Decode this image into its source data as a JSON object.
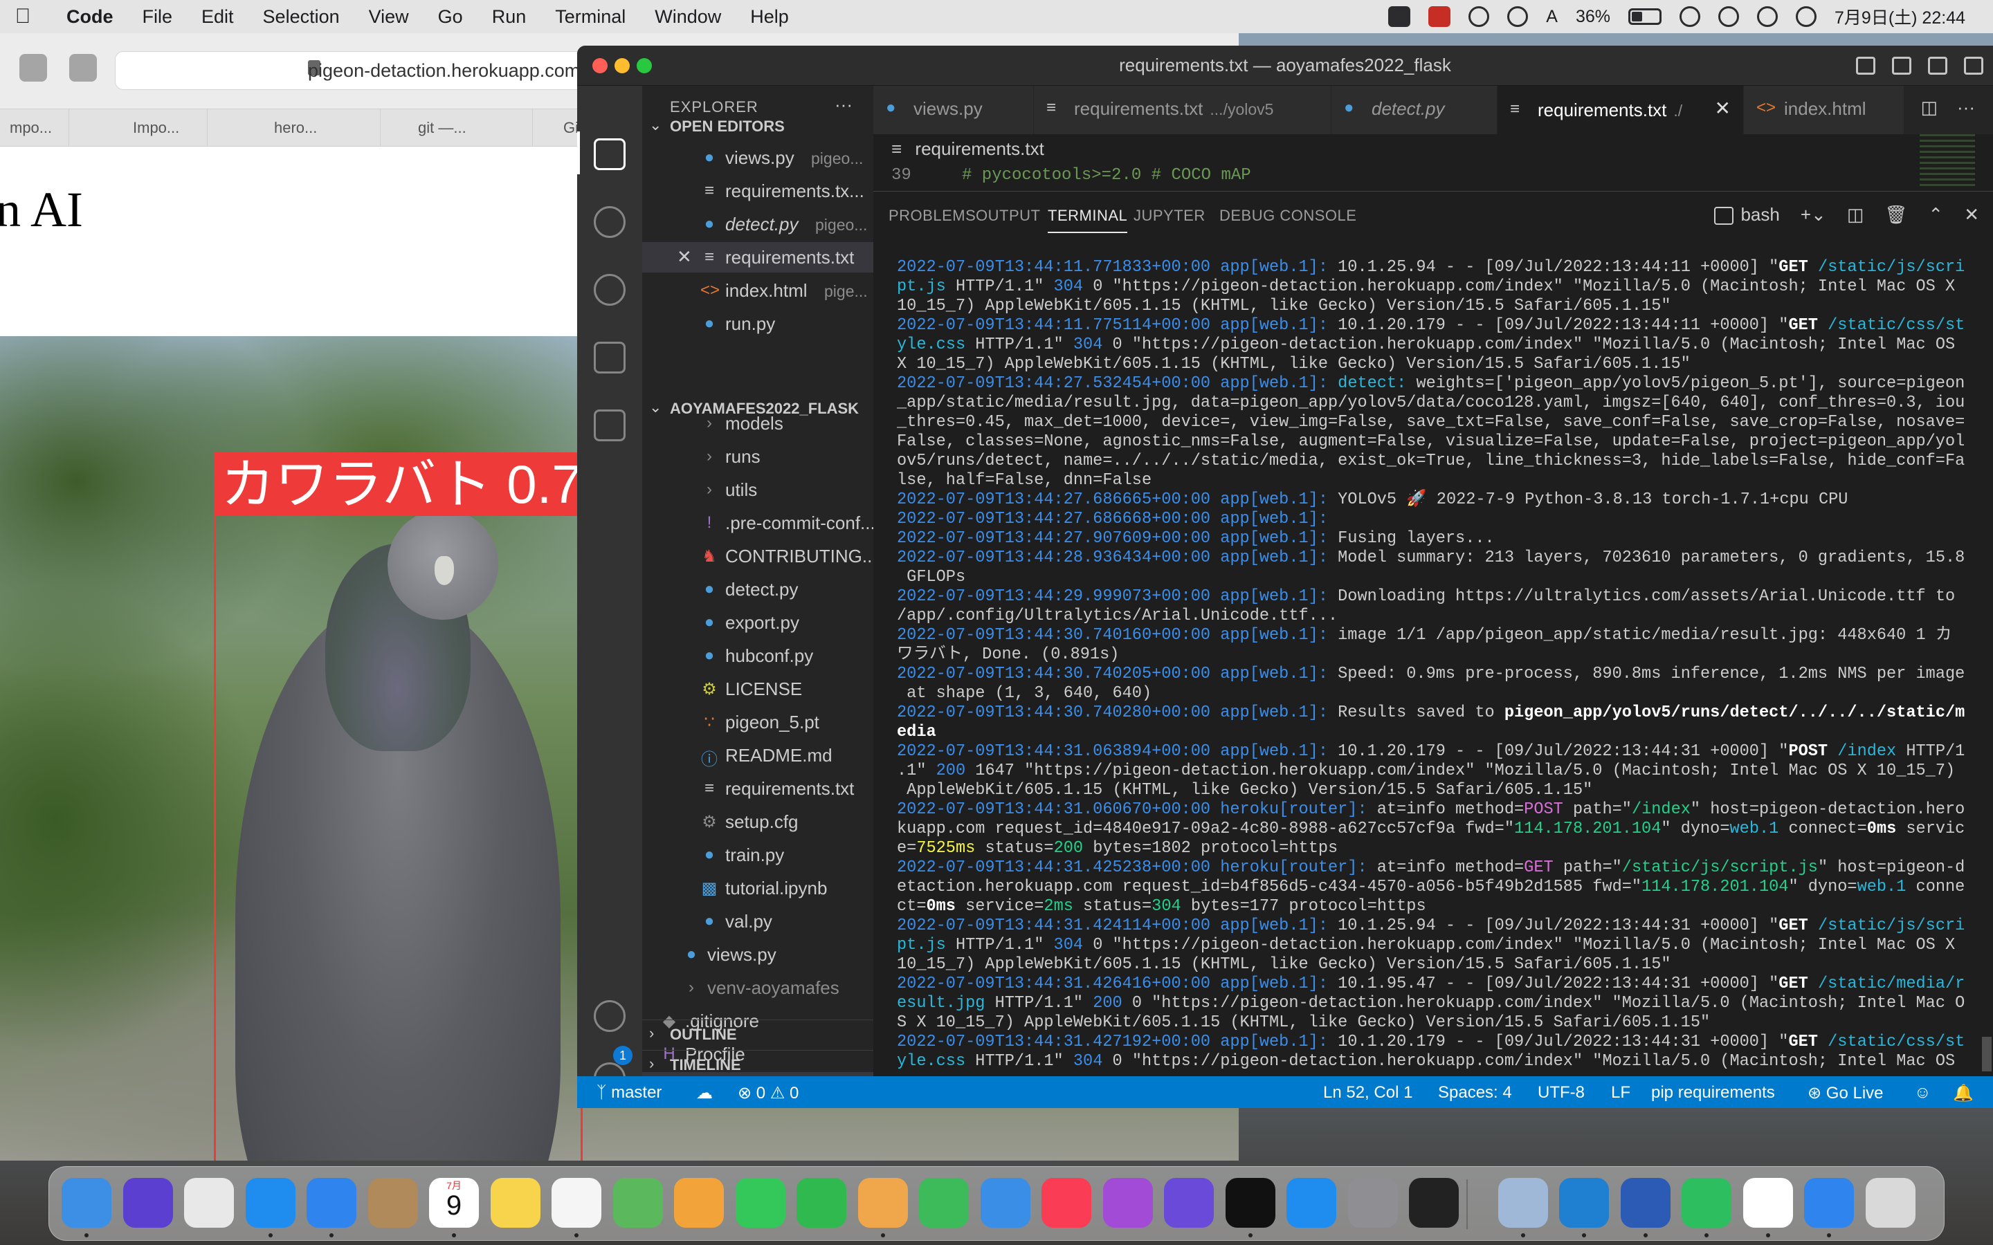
{
  "menubar": {
    "app_name": "Code",
    "menus": [
      "File",
      "Edit",
      "Selection",
      "View",
      "Go",
      "Run",
      "Terminal",
      "Window",
      "Help"
    ],
    "battery_percent": "36%",
    "input_method": "A",
    "datetime": "7月9日(土)  22:44"
  },
  "safari": {
    "url": "pigeon-detaction.herokuapp.com",
    "tabs": [
      "mpo...",
      "Impo...",
      "hero...",
      "git —...",
      "Gi"
    ],
    "heading": "n AI",
    "detection_label": "カワラバト 0.71"
  },
  "vscode": {
    "window_title": "requirements.txt — aoyamafes2022_flask",
    "explorer_title": "EXPLORER",
    "open_editors_title": "OPEN EDITORS",
    "open_editors": [
      {
        "name": "views.py",
        "desc": "pigeo...",
        "icon": "python-file-icon"
      },
      {
        "name": "requirements.tx...",
        "desc": "",
        "icon": "text-file-icon"
      },
      {
        "name": "detect.py",
        "desc": "pigeo...",
        "icon": "python-file-icon",
        "italic": true
      },
      {
        "name": "requirements.txt",
        "desc": "",
        "icon": "text-file-icon",
        "selected": true
      },
      {
        "name": "index.html",
        "desc": "pige...",
        "icon": "html-file-icon"
      },
      {
        "name": "run.py",
        "desc": "",
        "icon": "python-file-icon"
      }
    ],
    "project_title": "AOYAMAFES2022_FLASK",
    "tree_items": [
      {
        "name": "models",
        "kind": "folder",
        "indent": 2
      },
      {
        "name": "runs",
        "kind": "folder",
        "indent": 2
      },
      {
        "name": "utils",
        "kind": "folder",
        "indent": 2
      },
      {
        "name": ".pre-commit-conf...",
        "kind": "yaml",
        "indent": 2
      },
      {
        "name": "CONTRIBUTING....",
        "kind": "contrib",
        "indent": 2
      },
      {
        "name": "detect.py",
        "kind": "python",
        "indent": 2
      },
      {
        "name": "export.py",
        "kind": "python",
        "indent": 2
      },
      {
        "name": "hubconf.py",
        "kind": "python",
        "indent": 2
      },
      {
        "name": "LICENSE",
        "kind": "license",
        "indent": 2
      },
      {
        "name": "pigeon_5.pt",
        "kind": "rss",
        "indent": 2
      },
      {
        "name": "README.md",
        "kind": "info",
        "indent": 2
      },
      {
        "name": "requirements.txt",
        "kind": "text",
        "indent": 2
      },
      {
        "name": "setup.cfg",
        "kind": "gear",
        "indent": 2
      },
      {
        "name": "train.py",
        "kind": "python",
        "indent": 2
      },
      {
        "name": "tutorial.ipynb",
        "kind": "notebook",
        "indent": 2
      },
      {
        "name": "val.py",
        "kind": "python",
        "indent": 2
      },
      {
        "name": "views.py",
        "kind": "python",
        "indent": 1
      },
      {
        "name": "venv-aoyamafes",
        "kind": "folder-dim",
        "indent": 1
      },
      {
        "name": ".gitignore",
        "kind": "git",
        "indent": 0
      },
      {
        "name": "Procfile",
        "kind": "heroku",
        "indent": 0
      },
      {
        "name": "requirements.txt",
        "kind": "text",
        "indent": 0,
        "selected": true
      },
      {
        "name": "run.py",
        "kind": "python",
        "indent": 0
      }
    ],
    "outline_title": "OUTLINE",
    "timeline_title": "TIMELINE",
    "settings_badge": "1",
    "editor_tabs": [
      {
        "label": "views.py",
        "desc": "",
        "icon": "python-file-icon"
      },
      {
        "label": "requirements.txt",
        "desc": ".../yolov5",
        "icon": "text-file-icon"
      },
      {
        "label": "detect.py",
        "desc": "",
        "icon": "python-file-icon",
        "italic": true
      },
      {
        "label": "requirements.txt",
        "desc": "./",
        "icon": "text-file-icon",
        "active": true
      },
      {
        "label": "index.html",
        "desc": "",
        "icon": "html-file-icon"
      }
    ],
    "breadcrumb": "requirements.txt",
    "editor_line_number": "39",
    "editor_line_code": "# pycocotools>=2.0  # COCO mAP",
    "panel_tabs": [
      "PROBLEMS",
      "OUTPUT",
      "TERMINAL",
      "JUPYTER",
      "DEBUG CONSOLE"
    ],
    "active_panel_tab": "TERMINAL",
    "shell_name": "bash",
    "status": {
      "branch": "master",
      "errors": "0",
      "warnings": "0",
      "position": "Ln 52, Col 1",
      "spaces": "Spaces: 4",
      "encoding": "UTF-8",
      "eol": "LF",
      "language": "pip requirements",
      "go_live": "Go Live"
    }
  },
  "terminal_lines": [
    [
      [
        "t-ts",
        "2022-07-09T13:44:11.771833+00:00 app[web.1]:"
      ],
      [
        "t-dflt",
        " 10.1.25.94 - - [09/Jul/2022:13:44:11 +0000] \""
      ],
      [
        "t-hl",
        "GET"
      ],
      [
        "t-dflt",
        " "
      ],
      [
        "t-path",
        "/static/js/scri"
      ]
    ],
    [
      [
        "t-path",
        "pt.js"
      ],
      [
        "t-dflt",
        " HTTP/1.1\" "
      ],
      [
        "t-num",
        "304"
      ],
      [
        "t-dflt",
        " 0 \"https://pigeon-detaction.herokuapp.com/index\" \"Mozilla/5.0 (Macintosh; Intel Mac OS X"
      ]
    ],
    [
      [
        "t-dflt",
        "10_15_7) AppleWebKit/605.1.15 (KHTML, like Gecko) Version/15.5 Safari/605.1.15\""
      ]
    ],
    [
      [
        "t-ts",
        "2022-07-09T13:44:11.775114+00:00 app[web.1]:"
      ],
      [
        "t-dflt",
        " 10.1.20.179 - - [09/Jul/2022:13:44:11 +0000] \""
      ],
      [
        "t-hl",
        "GET"
      ],
      [
        "t-dflt",
        " "
      ],
      [
        "t-path",
        "/static/css/st"
      ]
    ],
    [
      [
        "t-path",
        "yle.css"
      ],
      [
        "t-dflt",
        " HTTP/1.1\" "
      ],
      [
        "t-num",
        "304"
      ],
      [
        "t-dflt",
        " 0 \"https://pigeon-detaction.herokuapp.com/index\" \"Mozilla/5.0 (Macintosh; Intel Mac OS"
      ]
    ],
    [
      [
        "t-dflt",
        "X 10_15_7) AppleWebKit/605.1.15 (KHTML, like Gecko) Version/15.5 Safari/605.1.15\""
      ]
    ],
    [
      [
        "t-ts",
        "2022-07-09T13:44:27.532454+00:00 app[web.1]:"
      ],
      [
        "t-dflt",
        " "
      ],
      [
        "t-path",
        "detect: "
      ],
      [
        "t-dflt",
        "weights=['pigeon_app/yolov5/pigeon_5.pt'], source=pigeon"
      ]
    ],
    [
      [
        "t-dflt",
        "_app/static/media/result.jpg, data=pigeon_app/yolov5/data/coco128.yaml, imgsz=[640, 640], conf_thres=0.3, iou"
      ]
    ],
    [
      [
        "t-dflt",
        "_thres=0.45, max_det=1000, device=, view_img=False, save_txt=False, save_conf=False, save_crop=False, nosave="
      ]
    ],
    [
      [
        "t-dflt",
        "False, classes=None, agnostic_nms=False, augment=False, visualize=False, update=False, project=pigeon_app/yol"
      ]
    ],
    [
      [
        "t-dflt",
        "ov5/runs/detect, name=../../../static/media, exist_ok=True, line_thickness=3, hide_labels=False, hide_conf=Fa"
      ]
    ],
    [
      [
        "t-dflt",
        "lse, half=False, dnn=False"
      ]
    ],
    [
      [
        "t-ts",
        "2022-07-09T13:44:27.686665+00:00 app[web.1]:"
      ],
      [
        "t-dflt",
        " YOLOv5 🚀 2022-7-9 Python-3.8.13 torch-1.7.1+cpu CPU"
      ]
    ],
    [
      [
        "t-ts",
        "2022-07-09T13:44:27.686668+00:00 app[web.1]:"
      ]
    ],
    [
      [
        "t-ts",
        "2022-07-09T13:44:27.907609+00:00 app[web.1]:"
      ],
      [
        "t-dflt",
        " Fusing layers..."
      ]
    ],
    [
      [
        "t-ts",
        "2022-07-09T13:44:28.936434+00:00 app[web.1]:"
      ],
      [
        "t-dflt",
        " Model summary: 213 layers, 7023610 parameters, 0 gradients, 15.8"
      ]
    ],
    [
      [
        "t-dflt",
        " GFLOPs"
      ]
    ],
    [
      [
        "t-ts",
        "2022-07-09T13:44:29.999073+00:00 app[web.1]:"
      ],
      [
        "t-dflt",
        " Downloading https://ultralytics.com/assets/Arial.Unicode.ttf to"
      ]
    ],
    [
      [
        "t-dflt",
        "/app/.config/Ultralytics/Arial.Unicode.ttf..."
      ]
    ],
    [
      [
        "t-ts",
        "2022-07-09T13:44:30.740160+00:00 app[web.1]:"
      ],
      [
        "t-dflt",
        " image 1/1 /app/pigeon_app/static/media/result.jpg: 448x640 1 カ"
      ]
    ],
    [
      [
        "t-dflt",
        "ワラバト, Done. (0.891s)"
      ]
    ],
    [
      [
        "t-ts",
        "2022-07-09T13:44:30.740205+00:00 app[web.1]:"
      ],
      [
        "t-dflt",
        " Speed: 0.9ms pre-process, 890.8ms inference, 1.2ms NMS per image"
      ]
    ],
    [
      [
        "t-dflt",
        " at shape (1, 3, 640, 640)"
      ]
    ],
    [
      [
        "t-ts",
        "2022-07-09T13:44:30.740280+00:00 app[web.1]:"
      ],
      [
        "t-dflt",
        " Results saved to "
      ],
      [
        "t-bold",
        "pigeon_app/yolov5/runs/detect/../../../static/m"
      ]
    ],
    [
      [
        "t-bold",
        "edia"
      ]
    ],
    [
      [
        "t-ts",
        "2022-07-09T13:44:31.063894+00:00 app[web.1]:"
      ],
      [
        "t-dflt",
        " 10.1.20.179 - - [09/Jul/2022:13:44:31 +0000] \""
      ],
      [
        "t-hl",
        "POST"
      ],
      [
        "t-dflt",
        " "
      ],
      [
        "t-path",
        "/index"
      ],
      [
        "t-dflt",
        " HTTP/1"
      ]
    ],
    [
      [
        "t-dflt",
        ".1\" "
      ],
      [
        "t-num",
        "200"
      ],
      [
        "t-dflt",
        " 1647 \"https://pigeon-detaction.herokuapp.com/index\" \"Mozilla/5.0 (Macintosh; Intel Mac OS X 10_15_7)"
      ]
    ],
    [
      [
        "t-dflt",
        " AppleWebKit/605.1.15 (KHTML, like Gecko) Version/15.5 Safari/605.1.15\""
      ]
    ],
    [
      [
        "t-ts",
        "2022-07-09T13:44:31.060670+00:00 heroku[router]:"
      ],
      [
        "t-dflt",
        " at=info method="
      ],
      [
        "t-mag",
        "POST"
      ],
      [
        "t-dflt",
        " path=\""
      ],
      [
        "t-grn",
        "/index"
      ],
      [
        "t-dflt",
        "\" host=pigeon-detaction.hero"
      ]
    ],
    [
      [
        "t-dflt",
        "kuapp.com request_id=4840e917-09a2-4c80-8988-a627cc57cf9a fwd=\""
      ],
      [
        "t-grn",
        "114.178.201.104"
      ],
      [
        "t-dflt",
        "\" dyno="
      ],
      [
        "t-path",
        "web.1"
      ],
      [
        "t-dflt",
        " connect="
      ],
      [
        "t-bold",
        "0ms"
      ],
      [
        "t-dflt",
        " servic"
      ]
    ],
    [
      [
        "t-dflt",
        "e="
      ],
      [
        "t-yel",
        "7525ms"
      ],
      [
        "t-dflt",
        " status="
      ],
      [
        "t-grn",
        "200"
      ],
      [
        "t-dflt",
        " bytes=1802 protocol=https"
      ]
    ],
    [
      [
        "t-ts",
        "2022-07-09T13:44:31.425238+00:00 heroku[router]:"
      ],
      [
        "t-dflt",
        " at=info method="
      ],
      [
        "t-mag",
        "GET"
      ],
      [
        "t-dflt",
        " path=\""
      ],
      [
        "t-grn",
        "/static/js/script.js"
      ],
      [
        "t-dflt",
        "\" host=pigeon-d"
      ]
    ],
    [
      [
        "t-dflt",
        "etaction.herokuapp.com request_id=b4f856d5-c434-4570-a056-b5f49b2d1585 fwd=\""
      ],
      [
        "t-grn",
        "114.178.201.104"
      ],
      [
        "t-dflt",
        "\" dyno="
      ],
      [
        "t-path",
        "web.1"
      ],
      [
        "t-dflt",
        " conne"
      ]
    ],
    [
      [
        "t-dflt",
        "ct="
      ],
      [
        "t-bold",
        "0ms"
      ],
      [
        "t-dflt",
        " service="
      ],
      [
        "t-grn",
        "2ms"
      ],
      [
        "t-dflt",
        " status="
      ],
      [
        "t-grn",
        "304"
      ],
      [
        "t-dflt",
        " bytes=177 protocol=https"
      ]
    ],
    [
      [
        "t-ts",
        "2022-07-09T13:44:31.424114+00:00 app[web.1]:"
      ],
      [
        "t-dflt",
        " 10.1.25.94 - - [09/Jul/2022:13:44:31 +0000] \""
      ],
      [
        "t-hl",
        "GET"
      ],
      [
        "t-dflt",
        " "
      ],
      [
        "t-path",
        "/static/js/scri"
      ]
    ],
    [
      [
        "t-path",
        "pt.js"
      ],
      [
        "t-dflt",
        " HTTP/1.1\" "
      ],
      [
        "t-num",
        "304"
      ],
      [
        "t-dflt",
        " 0 \"https://pigeon-detaction.herokuapp.com/index\" \"Mozilla/5.0 (Macintosh; Intel Mac OS X"
      ]
    ],
    [
      [
        "t-dflt",
        "10_15_7) AppleWebKit/605.1.15 (KHTML, like Gecko) Version/15.5 Safari/605.1.15\""
      ]
    ],
    [
      [
        "t-ts",
        "2022-07-09T13:44:31.426416+00:00 app[web.1]:"
      ],
      [
        "t-dflt",
        " 10.1.95.47 - - [09/Jul/2022:13:44:31 +0000] \""
      ],
      [
        "t-hl",
        "GET"
      ],
      [
        "t-dflt",
        " "
      ],
      [
        "t-path",
        "/static/media/r"
      ]
    ],
    [
      [
        "t-path",
        "esult.jpg"
      ],
      [
        "t-dflt",
        " HTTP/1.1\" "
      ],
      [
        "t-num",
        "200"
      ],
      [
        "t-dflt",
        " 0 \"https://pigeon-detaction.herokuapp.com/index\" \"Mozilla/5.0 (Macintosh; Intel Mac O"
      ]
    ],
    [
      [
        "t-dflt",
        "S X 10_15_7) AppleWebKit/605.1.15 (KHTML, like Gecko) Version/15.5 Safari/605.1.15\""
      ]
    ],
    [
      [
        "t-ts",
        "2022-07-09T13:44:31.427192+00:00 app[web.1]:"
      ],
      [
        "t-dflt",
        " 10.1.20.179 - - [09/Jul/2022:13:44:31 +0000] \""
      ],
      [
        "t-hl",
        "GET"
      ],
      [
        "t-dflt",
        " "
      ],
      [
        "t-path",
        "/static/css/st"
      ]
    ],
    [
      [
        "t-path",
        "yle.css"
      ],
      [
        "t-dflt",
        " HTTP/1.1\" "
      ],
      [
        "t-num",
        "304"
      ],
      [
        "t-dflt",
        " 0 \"https://pigeon-detaction.herokuapp.com/index\" \"Mozilla/5.0 (Macintosh; Intel Mac OS"
      ]
    ]
  ],
  "dock": {
    "calendar_month": "7月",
    "calendar_day": "9",
    "apps": [
      {
        "name": "finder-icon",
        "color": "#3d8fe6"
      },
      {
        "name": "siri-icon",
        "color": "#5a3fd0"
      },
      {
        "name": "launchpad-icon",
        "color": "#e8e8e8"
      },
      {
        "name": "safari-icon",
        "color": "#1f8cf0"
      },
      {
        "name": "mail-icon",
        "color": "#2f84ee"
      },
      {
        "name": "contacts-icon",
        "color": "#b08a5a"
      },
      {
        "name": "calendar-icon",
        "color": "#ffffff"
      },
      {
        "name": "notes-icon",
        "color": "#f8d34c"
      },
      {
        "name": "reminders-icon",
        "color": "#f5f5f5"
      },
      {
        "name": "maps-icon",
        "color": "#5cb85c"
      },
      {
        "name": "photos-icon",
        "color": "#f2a33a"
      },
      {
        "name": "messages-icon",
        "color": "#34c759"
      },
      {
        "name": "facetime-icon",
        "color": "#30b94f"
      },
      {
        "name": "pages-icon",
        "color": "#f0a64a"
      },
      {
        "name": "numbers-icon",
        "color": "#3dbb5a"
      },
      {
        "name": "keynote-icon",
        "color": "#3a8ee6"
      },
      {
        "name": "music-icon",
        "color": "#fa3c55"
      },
      {
        "name": "podcasts-icon",
        "color": "#a24bd6"
      },
      {
        "name": "imovie-icon",
        "color": "#6a4ad8"
      },
      {
        "name": "appletv-icon",
        "color": "#111111"
      },
      {
        "name": "appstore-icon",
        "color": "#1f8cf0"
      },
      {
        "name": "system-preferences-icon",
        "color": "#8e8e93"
      },
      {
        "name": "terminal-icon",
        "color": "#222222"
      },
      {
        "name": "preview-icon",
        "color": "#9fb8d8"
      },
      {
        "name": "vscode-icon",
        "color": "#1f7fd0"
      },
      {
        "name": "word-icon",
        "color": "#2b5bb5"
      },
      {
        "name": "evernote-icon",
        "color": "#2dbe60"
      },
      {
        "name": "slack-icon",
        "color": "#ffffff"
      },
      {
        "name": "mail-alt-icon",
        "color": "#2f84ee"
      },
      {
        "name": "trash-icon",
        "color": "#d9d9d9"
      }
    ]
  }
}
